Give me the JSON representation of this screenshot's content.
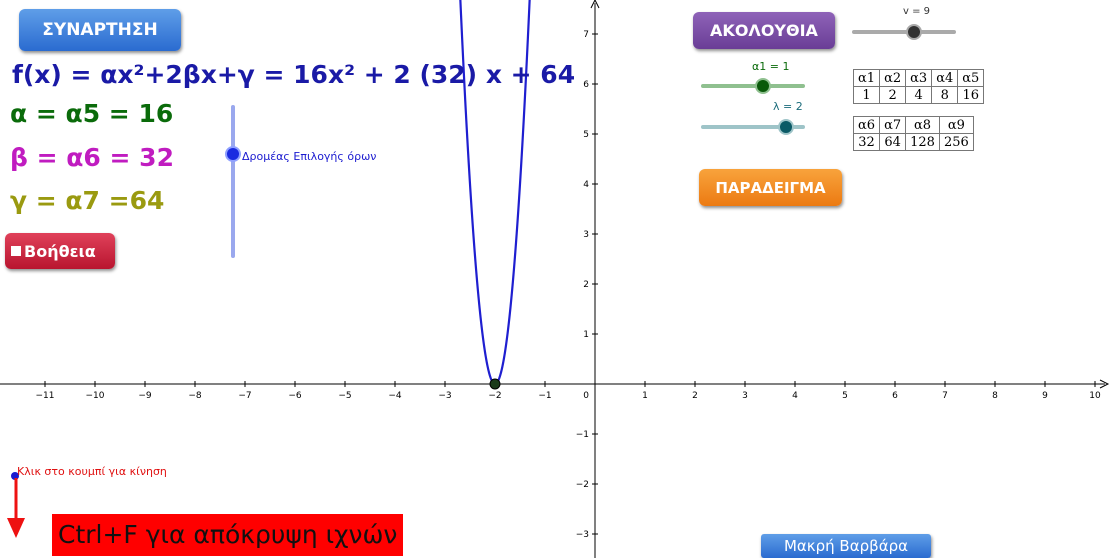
{
  "buttons": {
    "function": "ΣΥΝΑΡΤΗΣΗ",
    "sequence": "ΑΚΟΛΟΥΘΙΑ",
    "example": "ΠΑΡΑΔΕΙΓΜΑ",
    "help": "Βοήθεια",
    "author": "Μακρή Βαρβάρα"
  },
  "formula": {
    "fx": "f(x) = αx²+2βx+γ = 16x² + 2 (32) x + 64",
    "alpha": "α = α5 = 16",
    "beta": "β = α6  = 32",
    "gamma": "γ = α7 =64"
  },
  "colors": {
    "fx": "#1a1aa6",
    "alpha": "#0a6b0a",
    "beta": "#c01cc0",
    "gamma": "#9a9a10",
    "curve": "#1f1fd0"
  },
  "sliders": {
    "v": {
      "label": "v = 9",
      "value_fraction": 0.6
    },
    "a1": {
      "label": "α1 = 1",
      "value_fraction": 0.6
    },
    "lambda": {
      "label": "λ = 2",
      "value_fraction": 0.82
    },
    "term_selector": {
      "label": "Δρομέας Επιλογής όρων",
      "value_fraction": 0.68
    }
  },
  "sequence_table_1": {
    "headers": [
      "α1",
      "α2",
      "α3",
      "α4",
      "α5"
    ],
    "values": [
      "1",
      "2",
      "4",
      "8",
      "16"
    ]
  },
  "sequence_table_2": {
    "headers": [
      "α6",
      "α7",
      "α8",
      "α9"
    ],
    "values": [
      "32",
      "64",
      "128",
      "256"
    ]
  },
  "notes": {
    "click_hint": "Κλικ στο κουμπί για κίνηση",
    "ctrl_f": "Ctrl+F για απόκρυψη ιχνών"
  },
  "axes": {
    "x_ticks": [
      "−11",
      "−10",
      "−9",
      "−8",
      "−7",
      "−6",
      "−5",
      "−4",
      "−3",
      "−2",
      "−1",
      "1",
      "2",
      "3",
      "4",
      "5",
      "6",
      "7",
      "8",
      "9",
      "10"
    ],
    "y_ticks": [
      "7",
      "6",
      "5",
      "4",
      "3",
      "2",
      "1",
      "−1",
      "−2",
      "−3"
    ],
    "origin": "0"
  },
  "chart_data": {
    "type": "line",
    "function": "f(x) = 16x² + 64x + 64",
    "coefficients": {
      "a": 16,
      "b": 64,
      "c": 64
    },
    "vertex": [
      -2,
      0
    ],
    "xlim": [
      -11.8,
      10.4
    ],
    "ylim": [
      -3.4,
      7.6
    ],
    "grid": false
  }
}
